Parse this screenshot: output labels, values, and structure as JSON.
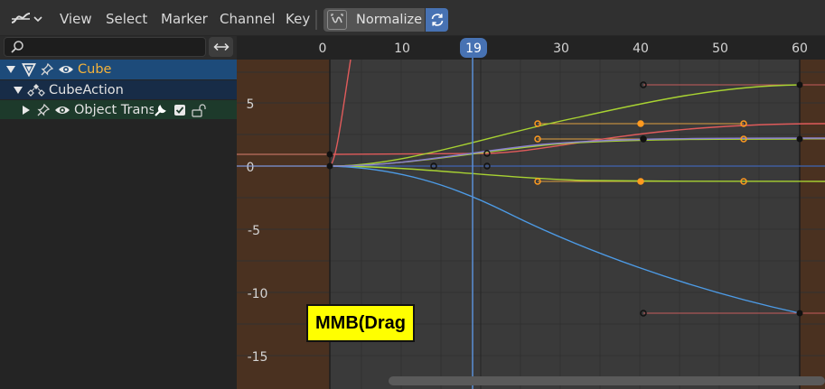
{
  "header": {
    "menus": [
      "View",
      "Select",
      "Marker",
      "Channel",
      "Key"
    ],
    "normalize_label": "Normalize"
  },
  "search": {
    "placeholder": ""
  },
  "channels": {
    "object_name": "Cube",
    "action_name": "CubeAction",
    "group_name": "Object Transf"
  },
  "timeline": {
    "frame_ticks": [
      "0",
      "10",
      "30",
      "40",
      "50",
      "60"
    ],
    "current_frame": "19"
  },
  "value_axis": {
    "ticks": [
      "5",
      "0",
      "-5",
      "-10",
      "-15"
    ]
  },
  "overlay": {
    "text": "MMB(Drag"
  },
  "colors": {
    "accent": "#4772b3",
    "object_row": "#1d4b7a",
    "action_row": "#172c47",
    "group_row": "#1d3a2b",
    "object_name": "#f3b23c",
    "out_of_range": "#4a3120",
    "playhead": "#5a8fd6",
    "curve_red": "#e05b5b",
    "curve_green": "#a8d232",
    "curve_blue": "#4d9be6",
    "keyframe_selected": "#ff9a1f"
  }
}
